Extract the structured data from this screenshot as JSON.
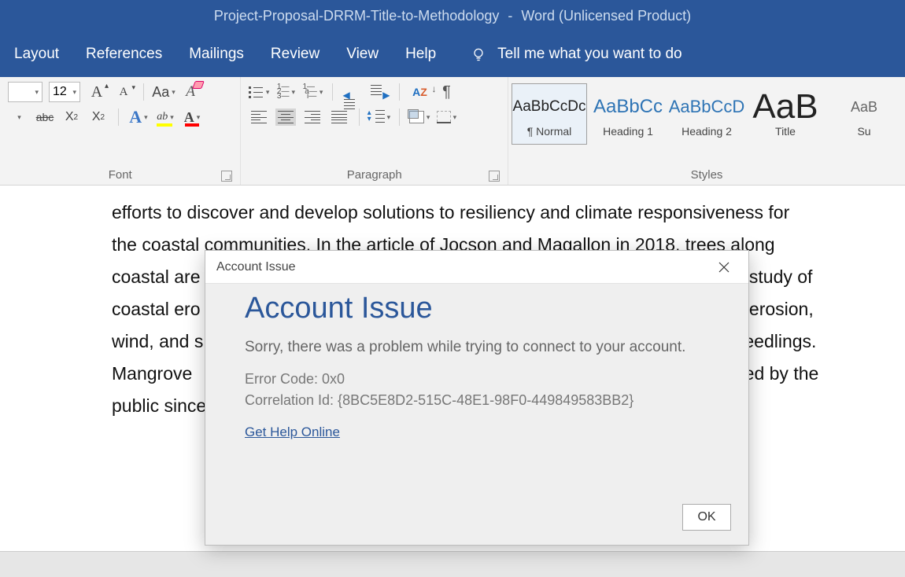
{
  "titlebar": {
    "doc_name": "Project-Proposal-DRRM-Title-to-Methodology",
    "app": "Word (Unlicensed Product)"
  },
  "tabs": {
    "layout": "Layout",
    "references": "References",
    "mailings": "Mailings",
    "review": "Review",
    "view": "View",
    "help": "Help",
    "tell_me": "Tell me what you want to do"
  },
  "ribbon": {
    "font_group_label": "Font",
    "para_group_label": "Paragraph",
    "styles_group_label": "Styles",
    "font_size": "12",
    "change_case": "Aa",
    "styles": {
      "normal_prev": "AaBbCcDc",
      "normal_name": "¶ Normal",
      "h1_prev": "AaBbCc",
      "h1_name": "Heading 1",
      "h2_prev": "AaBbCcD",
      "h2_name": "Heading 2",
      "title_prev": "AaB",
      "title_name": "Title",
      "sub_prev": "AaB",
      "sub_name": "Su"
    }
  },
  "doc": {
    "l1a": "efforts to discover and develop solutions to resiliency and climate responsiveness for",
    "l2a": "the coastal communities. In the article of ",
    "l2b": "Jocson",
    "l2c": " and ",
    "l2d": "Magallon",
    "l2e": " in 2018, trees along",
    "l3a": "coastal are",
    "l3b": " study of",
    "l4a": "coastal ero",
    "l4b": " erosion,",
    "l5a": "wind, and s",
    "l5b": "eedlings.",
    "l6a": "Mangrove ",
    "l6b": "ed by the",
    "l7a": "public since"
  },
  "dialog": {
    "header": "Account Issue",
    "title": "Account Issue",
    "message": "Sorry, there was a problem while trying to connect to your account.",
    "error_code": "Error Code: 0x0",
    "correlation": "Correlation Id: {8BC5E8D2-515C-48E1-98F0-449849583BB2}",
    "help_link": "Get Help Online",
    "ok": "OK"
  }
}
